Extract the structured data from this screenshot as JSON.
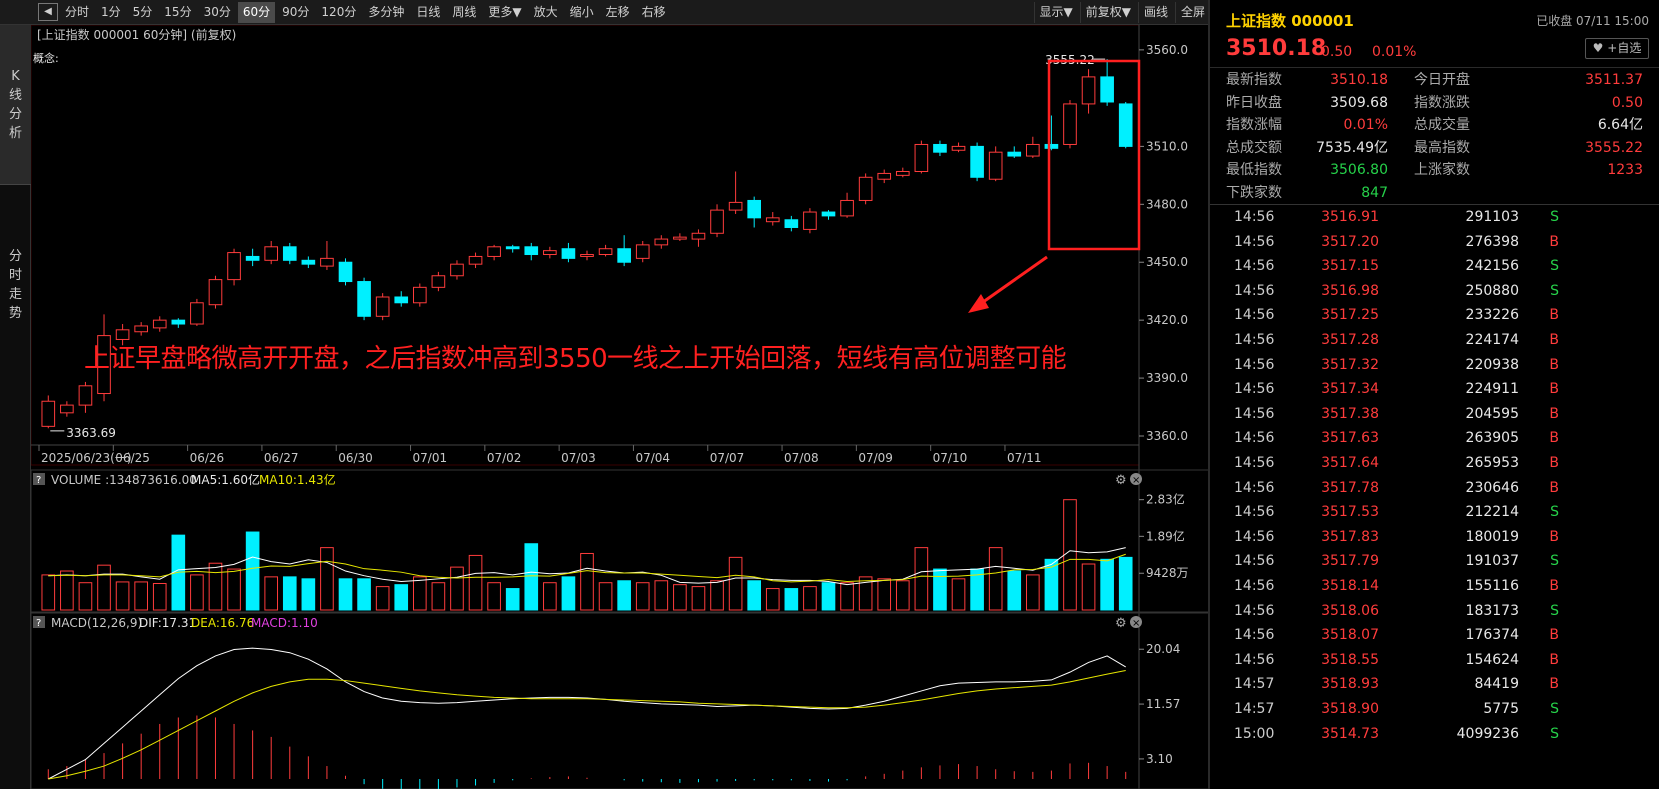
{
  "toolbar": {
    "back_icon": "play-back-icon",
    "periods": [
      "分时",
      "1分",
      "5分",
      "15分",
      "30分",
      "60分",
      "90分",
      "120分",
      "多分钟",
      "日线",
      "周线",
      "更多▼",
      "放大",
      "缩小",
      "左移",
      "右移"
    ],
    "active_period": "60分",
    "right_items": [
      "显示▼",
      "前复权▼",
      "画线",
      "全屏"
    ]
  },
  "sidebar": {
    "tabs": [
      "K线分析",
      "分时走势"
    ]
  },
  "chart": {
    "header": "[上证指数 000001 60分钟]  (前复权)",
    "concept_label": "概念:",
    "max_label": "3555.22",
    "min_label": "3363.69",
    "price_ticks": [
      "3560.0",
      "3510.0",
      "3480.0",
      "3450.0",
      "3420.0",
      "3390.0",
      "3360.0"
    ],
    "date_labels": [
      "2025/06/23(一)",
      "06/25",
      "06/26",
      "06/27",
      "06/30",
      "07/01",
      "07/02",
      "07/03",
      "07/04",
      "07/07",
      "07/08",
      "07/09",
      "07/10",
      "07/11"
    ],
    "volume_header": {
      "prefix": "VOLUME :134873616.00",
      "ma5": "MA5:1.60亿",
      "ma10": "MA10:1.43亿"
    },
    "volume_ticks": [
      "2.83亿",
      "1.89亿",
      "9428万"
    ],
    "macd_header": {
      "prefix": "MACD(12,26,9)",
      "dif": "DIF:17.31",
      "dea": "DEA:16.76",
      "macd": "MACD:1.10"
    },
    "macd_ticks": [
      "20.04",
      "11.57",
      "3.10"
    ],
    "help_icon": "question-icon",
    "settings_icon": "gear-icon",
    "close_icon": "close-icon"
  },
  "annotation": {
    "text": "上证早盘略微高开开盘，之后指数冲高到3550一线之上开始回落，短线有高位调整可能"
  },
  "colors": {
    "up": "#ff3c3c",
    "down": "#00f0ff",
    "ma5": "#ffffff",
    "ma10": "#e6e600",
    "title": "#ffd200",
    "annotation": "#ff2020"
  },
  "quote": {
    "name": "上证指数 000001",
    "status": "已收盘 07/11 15:00",
    "price": "3510.18",
    "change": "0.50",
    "pct": "0.01%",
    "watch_label": "+自选",
    "stats": [
      {
        "l1": "最新指数",
        "v1": "3510.18",
        "c1": "up",
        "l2": "今日开盘",
        "v2": "3511.37",
        "c2": "up"
      },
      {
        "l1": "昨日收盘",
        "v1": "3509.68",
        "c1": "wh",
        "l2": "指数涨跌",
        "v2": "0.50",
        "c2": "up"
      },
      {
        "l1": "指数涨幅",
        "v1": "0.01%",
        "c1": "up",
        "l2": "总成交量",
        "v2": "6.64亿",
        "c2": "wh"
      },
      {
        "l1": "总成交额",
        "v1": "7535.49亿",
        "c1": "wh",
        "l2": "最高指数",
        "v2": "3555.22",
        "c2": "up"
      },
      {
        "l1": "最低指数",
        "v1": "3506.80",
        "c1": "dn",
        "l2": "上涨家数",
        "v2": "1233",
        "c2": "up"
      },
      {
        "l1": "下跌家数",
        "v1": "847",
        "c1": "dn",
        "l2": "",
        "v2": "",
        "c2": "wh"
      }
    ]
  },
  "ticks": [
    {
      "time": "14:56",
      "price": "3516.91",
      "vol": "291103",
      "side": "S"
    },
    {
      "time": "14:56",
      "price": "3517.20",
      "vol": "276398",
      "side": "B"
    },
    {
      "time": "14:56",
      "price": "3517.15",
      "vol": "242156",
      "side": "S"
    },
    {
      "time": "14:56",
      "price": "3516.98",
      "vol": "250880",
      "side": "S"
    },
    {
      "time": "14:56",
      "price": "3517.25",
      "vol": "233226",
      "side": "B"
    },
    {
      "time": "14:56",
      "price": "3517.28",
      "vol": "224174",
      "side": "B"
    },
    {
      "time": "14:56",
      "price": "3517.32",
      "vol": "220938",
      "side": "B"
    },
    {
      "time": "14:56",
      "price": "3517.34",
      "vol": "224911",
      "side": "B"
    },
    {
      "time": "14:56",
      "price": "3517.38",
      "vol": "204595",
      "side": "B"
    },
    {
      "time": "14:56",
      "price": "3517.63",
      "vol": "263905",
      "side": "B"
    },
    {
      "time": "14:56",
      "price": "3517.64",
      "vol": "265953",
      "side": "B"
    },
    {
      "time": "14:56",
      "price": "3517.78",
      "vol": "230646",
      "side": "B"
    },
    {
      "time": "14:56",
      "price": "3517.53",
      "vol": "212214",
      "side": "S"
    },
    {
      "time": "14:56",
      "price": "3517.83",
      "vol": "180019",
      "side": "B"
    },
    {
      "time": "14:56",
      "price": "3517.79",
      "vol": "191037",
      "side": "S"
    },
    {
      "time": "14:56",
      "price": "3518.14",
      "vol": "155116",
      "side": "B"
    },
    {
      "time": "14:56",
      "price": "3518.06",
      "vol": "183173",
      "side": "S"
    },
    {
      "time": "14:56",
      "price": "3518.07",
      "vol": "176374",
      "side": "B"
    },
    {
      "time": "14:56",
      "price": "3518.55",
      "vol": "154624",
      "side": "B"
    },
    {
      "time": "14:57",
      "price": "3518.93",
      "vol": "84419",
      "side": "B"
    },
    {
      "time": "14:57",
      "price": "3518.90",
      "vol": "5775",
      "side": "S"
    },
    {
      "time": "15:00",
      "price": "3514.73",
      "vol": "4099236",
      "side": "S"
    }
  ],
  "chart_data": {
    "type": "candlestick",
    "symbol": "上证指数 000001",
    "interval": "60分",
    "price_range": [
      3360,
      3562
    ],
    "volume_max_yi": 2.95,
    "candles": [
      {
        "o": 3365,
        "c": 3378,
        "h": 3381,
        "l": 3364,
        "v": 0.9
      },
      {
        "o": 3372,
        "c": 3376,
        "h": 3378,
        "l": 3370,
        "v": 1.0
      },
      {
        "o": 3376,
        "c": 3386,
        "h": 3388,
        "l": 3372,
        "v": 0.7
      },
      {
        "o": 3382,
        "c": 3412,
        "h": 3423,
        "l": 3378,
        "v": 1.15
      },
      {
        "o": 3410,
        "c": 3415,
        "h": 3418,
        "l": 3407,
        "v": 0.72
      },
      {
        "o": 3414,
        "c": 3417,
        "h": 3419,
        "l": 3412,
        "v": 0.72
      },
      {
        "o": 3416,
        "c": 3420,
        "h": 3422,
        "l": 3414,
        "v": 0.68
      },
      {
        "o": 3420,
        "c": 3418,
        "h": 3421,
        "l": 3416,
        "v": 1.92
      },
      {
        "o": 3418,
        "c": 3429,
        "h": 3431,
        "l": 3417,
        "v": 0.9
      },
      {
        "o": 3428,
        "c": 3441,
        "h": 3443,
        "l": 3426,
        "v": 1.2
      },
      {
        "o": 3441,
        "c": 3455,
        "h": 3457,
        "l": 3438,
        "v": 1.05
      },
      {
        "o": 3453,
        "c": 3451,
        "h": 3457,
        "l": 3448,
        "v": 2.0
      },
      {
        "o": 3451,
        "c": 3458,
        "h": 3461,
        "l": 3449,
        "v": 0.85
      },
      {
        "o": 3458,
        "c": 3451,
        "h": 3460,
        "l": 3449,
        "v": 0.85
      },
      {
        "o": 3451,
        "c": 3449,
        "h": 3453,
        "l": 3447,
        "v": 0.8
      },
      {
        "o": 3448,
        "c": 3452,
        "h": 3461,
        "l": 3446,
        "v": 1.6
      },
      {
        "o": 3450,
        "c": 3440,
        "h": 3452,
        "l": 3438,
        "v": 0.8
      },
      {
        "o": 3440,
        "c": 3422,
        "h": 3442,
        "l": 3420,
        "v": 0.8
      },
      {
        "o": 3422,
        "c": 3432,
        "h": 3434,
        "l": 3420,
        "v": 0.6
      },
      {
        "o": 3432,
        "c": 3429,
        "h": 3435,
        "l": 3427,
        "v": 0.65
      },
      {
        "o": 3429,
        "c": 3437,
        "h": 3439,
        "l": 3427,
        "v": 0.85
      },
      {
        "o": 3437,
        "c": 3443,
        "h": 3445,
        "l": 3435,
        "v": 0.7
      },
      {
        "o": 3443,
        "c": 3449,
        "h": 3451,
        "l": 3441,
        "v": 1.1
      },
      {
        "o": 3449,
        "c": 3453,
        "h": 3455,
        "l": 3447,
        "v": 1.4
      },
      {
        "o": 3453,
        "c": 3458,
        "h": 3459,
        "l": 3451,
        "v": 0.7
      },
      {
        "o": 3458,
        "c": 3457,
        "h": 3459,
        "l": 3455,
        "v": 0.55
      },
      {
        "o": 3458,
        "c": 3454,
        "h": 3460,
        "l": 3451,
        "v": 1.7
      },
      {
        "o": 3454,
        "c": 3456,
        "h": 3458,
        "l": 3452,
        "v": 0.7
      },
      {
        "o": 3457,
        "c": 3452,
        "h": 3460,
        "l": 3450,
        "v": 0.85
      },
      {
        "o": 3453,
        "c": 3454,
        "h": 3456,
        "l": 3451,
        "v": 1.45
      },
      {
        "o": 3454,
        "c": 3457,
        "h": 3459,
        "l": 3453,
        "v": 0.7
      },
      {
        "o": 3457,
        "c": 3450,
        "h": 3464,
        "l": 3448,
        "v": 0.75
      },
      {
        "o": 3452,
        "c": 3459,
        "h": 3461,
        "l": 3450,
        "v": 0.7
      },
      {
        "o": 3459,
        "c": 3462,
        "h": 3464,
        "l": 3457,
        "v": 0.75
      },
      {
        "o": 3462,
        "c": 3463,
        "h": 3465,
        "l": 3461,
        "v": 0.65
      },
      {
        "o": 3462,
        "c": 3465,
        "h": 3467,
        "l": 3458,
        "v": 0.6
      },
      {
        "o": 3465,
        "c": 3477,
        "h": 3480,
        "l": 3463,
        "v": 0.75
      },
      {
        "o": 3477,
        "c": 3481,
        "h": 3497,
        "l": 3475,
        "v": 1.35
      },
      {
        "o": 3482,
        "c": 3473,
        "h": 3484,
        "l": 3468,
        "v": 0.75
      },
      {
        "o": 3471,
        "c": 3473,
        "h": 3476,
        "l": 3469,
        "v": 0.55
      },
      {
        "o": 3472,
        "c": 3468,
        "h": 3474,
        "l": 3466,
        "v": 0.55
      },
      {
        "o": 3467,
        "c": 3476,
        "h": 3478,
        "l": 3465,
        "v": 0.6
      },
      {
        "o": 3476,
        "c": 3474,
        "h": 3477,
        "l": 3472,
        "v": 0.7
      },
      {
        "o": 3474,
        "c": 3482,
        "h": 3486,
        "l": 3473,
        "v": 0.7
      },
      {
        "o": 3482,
        "c": 3494,
        "h": 3496,
        "l": 3480,
        "v": 0.85
      },
      {
        "o": 3493,
        "c": 3496,
        "h": 3498,
        "l": 3491,
        "v": 0.8
      },
      {
        "o": 3495,
        "c": 3497,
        "h": 3499,
        "l": 3494,
        "v": 0.75
      },
      {
        "o": 3497,
        "c": 3511,
        "h": 3513,
        "l": 3496,
        "v": 1.6
      },
      {
        "o": 3511,
        "c": 3507,
        "h": 3513,
        "l": 3505,
        "v": 1.05
      },
      {
        "o": 3508,
        "c": 3510,
        "h": 3512,
        "l": 3507,
        "v": 0.8
      },
      {
        "o": 3510,
        "c": 3494,
        "h": 3512,
        "l": 3492,
        "v": 1.05
      },
      {
        "o": 3493,
        "c": 3507,
        "h": 3510,
        "l": 3492,
        "v": 1.6
      },
      {
        "o": 3507,
        "c": 3505,
        "h": 3510,
        "l": 3504,
        "v": 1.0
      },
      {
        "o": 3505,
        "c": 3511,
        "h": 3515,
        "l": 3504,
        "v": 0.9
      },
      {
        "o": 3511,
        "c": 3509,
        "h": 3526,
        "l": 3508,
        "v": 1.3
      },
      {
        "o": 3511,
        "c": 3532,
        "h": 3534,
        "l": 3509,
        "v": 2.83
      },
      {
        "o": 3532,
        "c": 3546,
        "h": 3550,
        "l": 3527,
        "v": 1.18
      },
      {
        "o": 3546,
        "c": 3533,
        "h": 3555.22,
        "l": 3531,
        "v": 1.3
      },
      {
        "o": 3532,
        "c": 3510,
        "h": 3533,
        "l": 3509,
        "v": 1.35
      }
    ],
    "ma5_volume": [
      0.88,
      0.9,
      0.88,
      0.92,
      0.92,
      0.85,
      0.79,
      1.03,
      1.06,
      1.09,
      1.17,
      1.36,
      1.24,
      1.18,
      1.29,
      1.22,
      1.0,
      0.88,
      0.79,
      0.73,
      0.76,
      0.8,
      0.84,
      0.94,
      0.96,
      0.9,
      0.97,
      0.93,
      0.95,
      1.07,
      1.0,
      0.95,
      0.97,
      0.89,
      0.71,
      0.69,
      0.71,
      0.82,
      0.82,
      0.78,
      0.76,
      0.76,
      0.73,
      0.65,
      0.71,
      0.76,
      0.79,
      0.98,
      1.01,
      1.03,
      1.05,
      1.12,
      1.07,
      1.02,
      1.17,
      1.52,
      1.47,
      1.49,
      1.6
    ],
    "ma10_volume": [
      0.88,
      0.89,
      0.88,
      0.9,
      0.9,
      0.88,
      0.85,
      0.97,
      0.99,
      0.96,
      0.99,
      1.07,
      1.13,
      1.12,
      1.19,
      1.25,
      1.18,
      1.06,
      1.02,
      0.97,
      0.88,
      0.84,
      0.82,
      0.84,
      0.84,
      0.85,
      0.88,
      0.87,
      0.94,
      1.01,
      0.96,
      0.95,
      0.95,
      0.92,
      0.89,
      0.86,
      0.83,
      0.89,
      0.85,
      0.75,
      0.72,
      0.74,
      0.78,
      0.73,
      0.75,
      0.76,
      0.78,
      0.87,
      0.86,
      0.87,
      0.9,
      0.95,
      1.03,
      1.04,
      1.1,
      1.3,
      1.3,
      1.26,
      1.43
    ],
    "macd": {
      "dif": [
        0,
        1.5,
        3,
        5.5,
        8,
        10.5,
        13,
        15.5,
        17.5,
        19,
        20,
        20.2,
        20,
        19.5,
        18.5,
        17,
        15,
        13.5,
        12.5,
        12,
        11.8,
        11.7,
        11.8,
        12,
        12.2,
        12.4,
        12.5,
        12.6,
        12.6,
        12.5,
        12.3,
        12,
        11.8,
        11.6,
        11.5,
        11.4,
        11.2,
        11.3,
        11.4,
        11.3,
        11.1,
        10.9,
        10.8,
        10.9,
        11.4,
        12,
        12.8,
        13.6,
        14.4,
        14.8,
        14.9,
        15,
        15,
        15.1,
        15.3,
        16.5,
        18,
        19,
        17.31
      ],
      "dea": [
        0,
        0.5,
        1.2,
        2,
        3.2,
        4.5,
        6,
        7.5,
        9,
        10.5,
        12,
        13.3,
        14.3,
        15,
        15.4,
        15.4,
        15.2,
        14.8,
        14.4,
        14,
        13.6,
        13.3,
        13,
        12.8,
        12.6,
        12.5,
        12.4,
        12.4,
        12.4,
        12.4,
        12.3,
        12.2,
        12.1,
        12,
        11.9,
        11.7,
        11.6,
        11.5,
        11.4,
        11.3,
        11.2,
        11.1,
        11,
        11,
        11.1,
        11.4,
        11.8,
        12.2,
        12.7,
        13.2,
        13.6,
        13.9,
        14.1,
        14.3,
        14.5,
        15,
        15.6,
        16.2,
        16.76
      ],
      "hist": [
        1.5,
        2,
        3,
        4,
        5.5,
        7,
        8.5,
        9.5,
        9.8,
        9.5,
        8.5,
        7.5,
        6.5,
        5,
        3.5,
        2,
        0.5,
        -0.8,
        -1.5,
        -2,
        -1.9,
        -1.6,
        -1.3,
        -1,
        -0.6,
        -0.2,
        0.1,
        0.3,
        0.4,
        0.2,
        0,
        -0.2,
        -0.4,
        -0.5,
        -0.6,
        -0.5,
        -0.4,
        -0.3,
        -0.2,
        -0.2,
        -0.2,
        -0.3,
        -0.4,
        -0.2,
        0.4,
        0.8,
        1.3,
        1.8,
        2.1,
        2.3,
        2,
        1.5,
        1.2,
        1.1,
        1.3,
        2.4,
        2.5,
        2,
        1.1
      ]
    }
  }
}
